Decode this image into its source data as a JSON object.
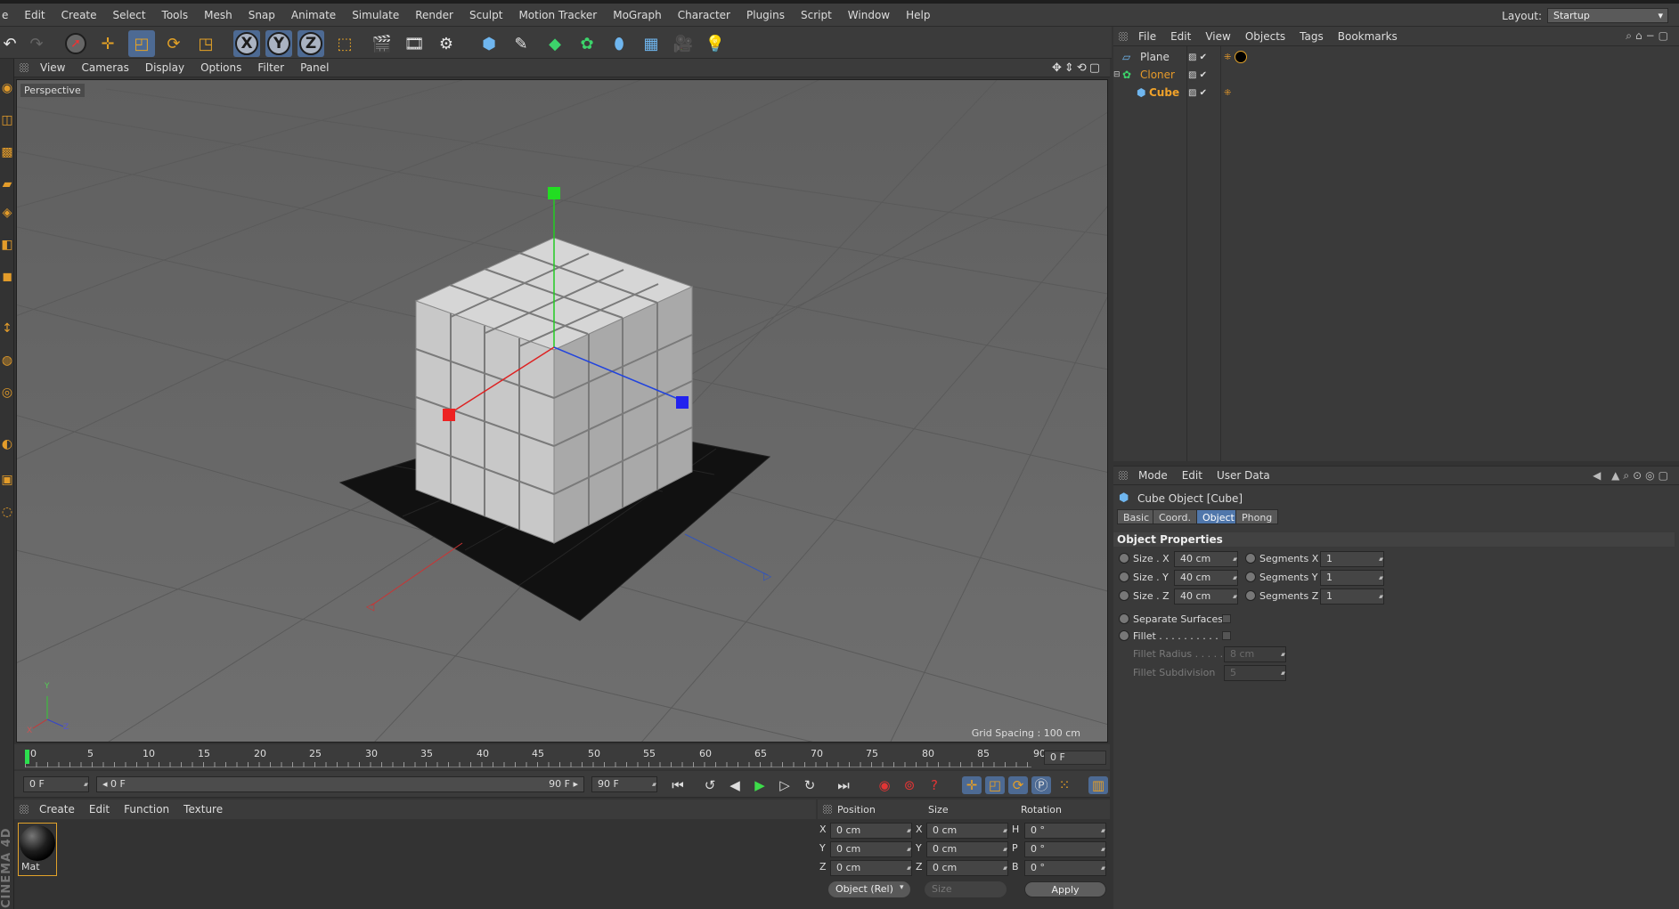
{
  "menubar": {
    "items": [
      "e",
      "Edit",
      "Create",
      "Select",
      "Tools",
      "Mesh",
      "Snap",
      "Animate",
      "Simulate",
      "Render",
      "Sculpt",
      "Motion Tracker",
      "MoGraph",
      "Character",
      "Plugins",
      "Script",
      "Window",
      "Help"
    ],
    "layout_label": "Layout:",
    "layout_value": "Startup"
  },
  "viewport": {
    "menu": [
      "View",
      "Cameras",
      "Display",
      "Options",
      "Filter",
      "Panel"
    ],
    "camera_label": "Perspective",
    "grid_spacing": "Grid Spacing : 100 cm",
    "axis_x": "X",
    "axis_y": "Y",
    "axis_z": "Z"
  },
  "timeline": {
    "ticks": [
      "0",
      "5",
      "10",
      "15",
      "20",
      "25",
      "30",
      "35",
      "40",
      "45",
      "50",
      "55",
      "60",
      "65",
      "70",
      "75",
      "80",
      "85",
      "90"
    ],
    "current_frame": "0 F",
    "start_field": "0 F",
    "range_start": "◂ 0 F",
    "range_end": "90 F ▸",
    "end_field": "90 F"
  },
  "material_manager": {
    "menu": [
      "Create",
      "Edit",
      "Function",
      "Texture"
    ],
    "material_name": "Mat",
    "brand": "CINEMA 4D"
  },
  "coordinates": {
    "headers": {
      "position": "Position",
      "size": "Size",
      "rotation": "Rotation"
    },
    "rows": [
      {
        "axis": "X",
        "pos": "0 cm",
        "size_axis": "X",
        "size": "0 cm",
        "rot_axis": "H",
        "rot": "0 °"
      },
      {
        "axis": "Y",
        "pos": "0 cm",
        "size_axis": "Y",
        "size": "0 cm",
        "rot_axis": "P",
        "rot": "0 °"
      },
      {
        "axis": "Z",
        "pos": "0 cm",
        "size_axis": "Z",
        "size": "0 cm",
        "rot_axis": "B",
        "rot": "0 °"
      }
    ],
    "mode_select": "Object (Rel)",
    "size_select": "Size",
    "apply_label": "Apply"
  },
  "object_manager": {
    "menu": [
      "File",
      "Edit",
      "View",
      "Objects",
      "Tags",
      "Bookmarks"
    ],
    "objects": [
      {
        "name": "Plane",
        "color": "#d9d9d9"
      },
      {
        "name": "Cloner",
        "color": "#e79a2a"
      },
      {
        "name": "Cube",
        "color": "#f0a22a"
      }
    ]
  },
  "attribute_manager": {
    "menu": [
      "Mode",
      "Edit",
      "User Data"
    ],
    "object_title": "Cube Object [Cube]",
    "tabs": [
      "Basic",
      "Coord.",
      "Object",
      "Phong"
    ],
    "active_tab": "Object",
    "section": "Object Properties",
    "size_x_label": "Size . X",
    "size_x": "40 cm",
    "size_y_label": "Size . Y",
    "size_y": "40 cm",
    "size_z_label": "Size . Z",
    "size_z": "40 cm",
    "seg_x_label": "Segments X",
    "seg_x": "1",
    "seg_y_label": "Segments Y",
    "seg_y": "1",
    "seg_z_label": "Segments Z",
    "seg_z": "1",
    "separate_surfaces": "Separate Surfaces",
    "fillet": "Fillet . . . . . . . . . .",
    "fillet_radius": "Fillet Radius . . . . .",
    "fillet_radius_value": "8 cm",
    "fillet_subdivision": "Fillet Subdivision",
    "fillet_subdivision_value": "5"
  },
  "colors": {
    "accent_blue": "#5077ab",
    "accent_orange": "#e79a2a",
    "background": "#333333"
  }
}
